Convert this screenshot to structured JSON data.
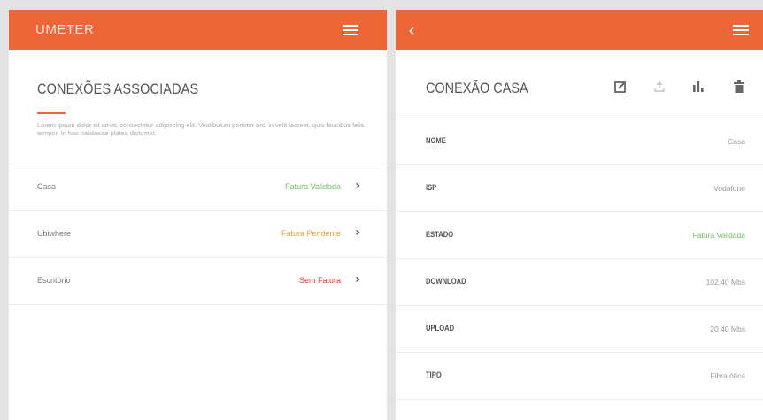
{
  "colors": {
    "accent": "#ee6637",
    "status_validated": "#6cbf5c",
    "status_pending": "#e4a13a",
    "status_none": "#e53935"
  },
  "left": {
    "brand": "UMETER",
    "menu_icon": "hamburger-menu-icon",
    "title": "CONEXÕES ASSOCIADAS",
    "description": "Lorem ipsum dolor sit amet, consectetur adipiscing elit. Vestibulum porttitor orci in velit laoreet, quis faucibus felis tempor. In hac habitasse platea dictumst.",
    "connections": [
      {
        "name": "Casa",
        "status": "Fatura Validada",
        "status_color": "#6cbf5c"
      },
      {
        "name": "Ubiwhere",
        "status": "Fatura Pendente",
        "status_color": "#e4a13a"
      },
      {
        "name": "Escritório",
        "status": "Sem Fatura",
        "status_color": "#e53935"
      }
    ]
  },
  "right": {
    "back_icon": "chevron-left-icon",
    "menu_icon": "hamburger-menu-icon",
    "title": "CONEXÃO CASA",
    "actions": [
      "edit-icon",
      "upload-icon",
      "bar-chart-icon",
      "trash-icon"
    ],
    "details": [
      {
        "label": "NOME",
        "value": "Casa",
        "value_color": "#999999"
      },
      {
        "label": "ISP",
        "value": "Vodafone",
        "value_color": "#999999"
      },
      {
        "label": "ESTADO",
        "value": "Fatura Validada",
        "value_color": "#6cbf5c"
      },
      {
        "label": "DOWNLOAD",
        "value": "102.40 Mbs",
        "value_color": "#999999"
      },
      {
        "label": "UPLOAD",
        "value": "20.40 Mbs",
        "value_color": "#999999"
      },
      {
        "label": "TIPO",
        "value": "Fibra ótica",
        "value_color": "#999999"
      }
    ]
  }
}
